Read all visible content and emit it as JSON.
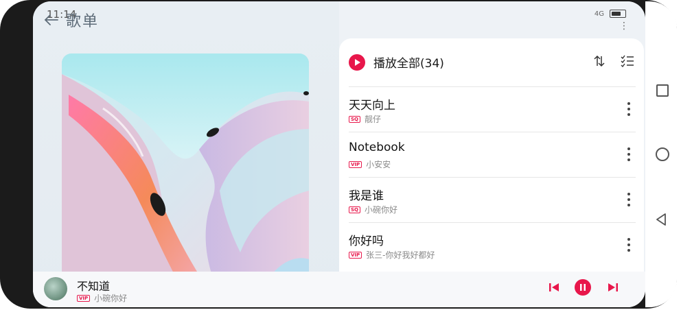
{
  "status": {
    "time": "11:14",
    "network": "4G"
  },
  "header": {
    "title": "歌单"
  },
  "playlist": {
    "play_all_label": "播放全部(34)",
    "songs": [
      {
        "title": "天天向上",
        "badge": "SQ",
        "artist": "靓仔"
      },
      {
        "title": "Notebook",
        "badge": "VIP",
        "artist": "小安安"
      },
      {
        "title": "我是谁",
        "badge": "SQ",
        "artist": "小碗你好"
      },
      {
        "title": "你好吗",
        "badge": "VIP",
        "artist": "张三-你好我好都好"
      }
    ]
  },
  "now_playing": {
    "title": "不知道",
    "badge": "VIP",
    "artist": "小碗你好"
  },
  "colors": {
    "accent": "#e8174b"
  },
  "icons": [
    "back-arrow-icon",
    "sort-icon",
    "multi-select-icon",
    "more-vert-icon",
    "play-icon",
    "previous-icon",
    "pause-icon",
    "next-icon",
    "battery-icon"
  ]
}
